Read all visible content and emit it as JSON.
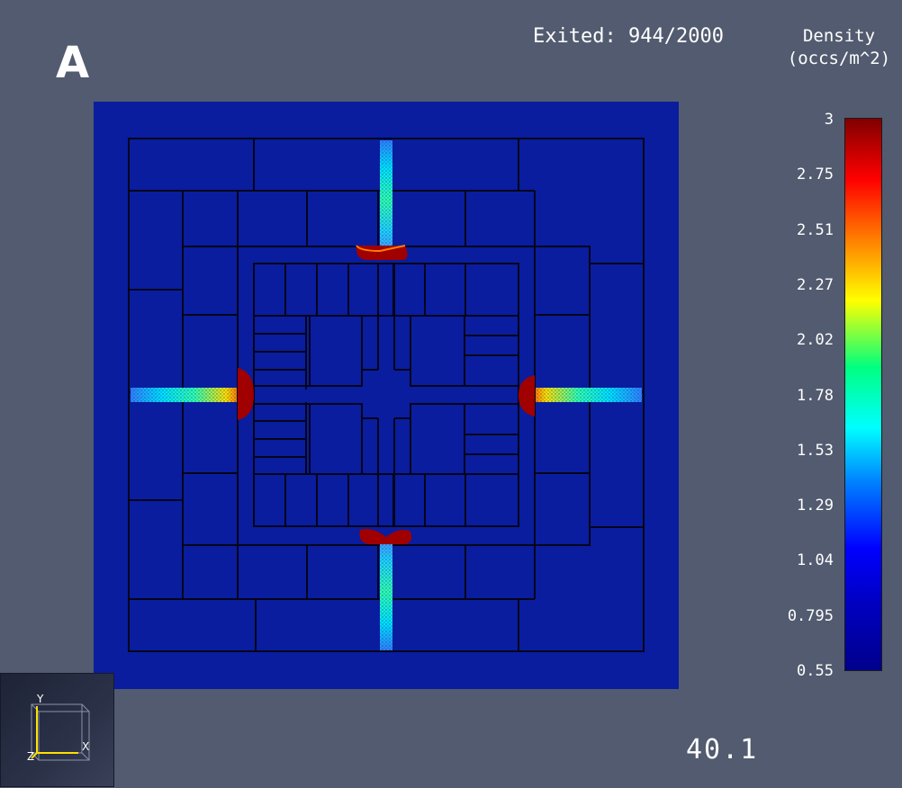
{
  "panel_letter": "A",
  "exited": {
    "label": "Exited:",
    "count": "944",
    "total": "/2000"
  },
  "legend": {
    "title_line1": "Density",
    "title_line2": "(occs/m^2)",
    "ticks": [
      "3",
      "2.75",
      "2.51",
      "2.27",
      "2.02",
      "1.78",
      "1.53",
      "1.29",
      "1.04",
      "0.795",
      "0.55"
    ],
    "colors": [
      "#800000",
      "#ff0000",
      "#ff8000",
      "#ffff00",
      "#00ff80",
      "#00ffff",
      "#0080ff",
      "#0000ff",
      "#00008c"
    ]
  },
  "time_display": "40.1",
  "axes": {
    "x_label": "X",
    "y_label": "Y",
    "z_label": "Z"
  },
  "colors": {
    "background": "#525b6f",
    "floor": "#0a1d9e",
    "walls": "#05051a",
    "high_density": "#a00000",
    "low_density": "#00ffff"
  }
}
